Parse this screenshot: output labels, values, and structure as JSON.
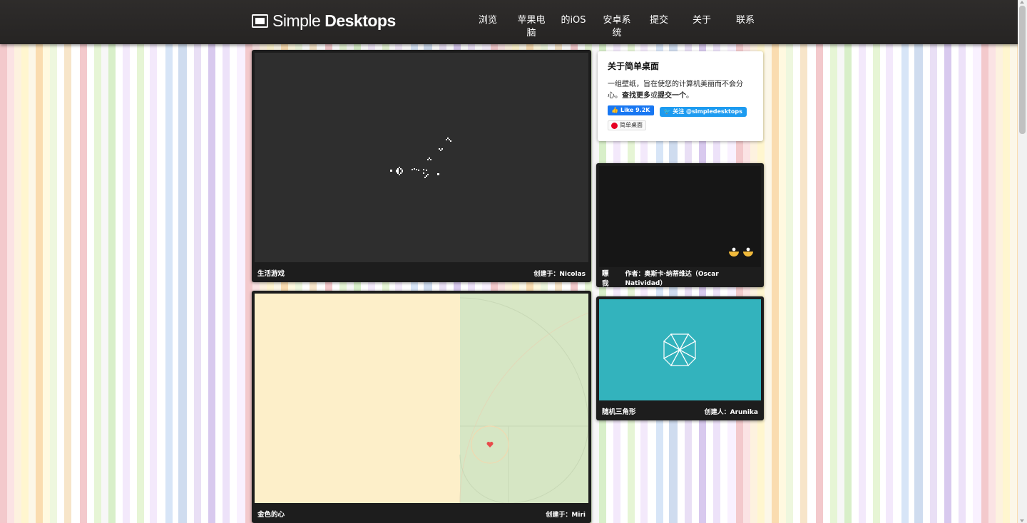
{
  "header": {
    "logo_light": "Simple ",
    "logo_bold": "Desktops",
    "nav": [
      {
        "label": "浏览"
      },
      {
        "label": "苹果电\n脑"
      },
      {
        "label": "的iOS"
      },
      {
        "label": "安卓系\n统"
      },
      {
        "label": "提交"
      },
      {
        "label": "关于"
      },
      {
        "label": "联系"
      }
    ]
  },
  "about": {
    "title": "关于简单桌面",
    "desc_prefix": "一组壁纸，旨在使您的计算机美丽而不会分心。",
    "find_more": "查找更多",
    "or": "或",
    "submit_one": "提交一个",
    "period": "。",
    "fb_like": "Like 9.2K",
    "twitter_follow": "关注 @simpledesktops",
    "pinterest": "简单桌面"
  },
  "wallpapers": [
    {
      "title": "生活游戏",
      "credit": "创建于：Nicolas"
    },
    {
      "title": "金色的心",
      "credit": "创建于：Miri"
    },
    {
      "title": "瞟我",
      "credit": "作者：奥斯卡·纳蒂维达（Oscar Natividad）"
    },
    {
      "title": "随机三角形",
      "credit": "创建人：Arunika"
    }
  ],
  "colors": {
    "header_bg": "#2a2827",
    "card_bg": "#1d1d1d",
    "life_bg": "#2e2e2e",
    "golden_left": "#fdefc9",
    "golden_right": "#d6e6c4",
    "heart": "#e84b4b",
    "teal": "#33b3bd",
    "dark_wall": "#161616"
  }
}
